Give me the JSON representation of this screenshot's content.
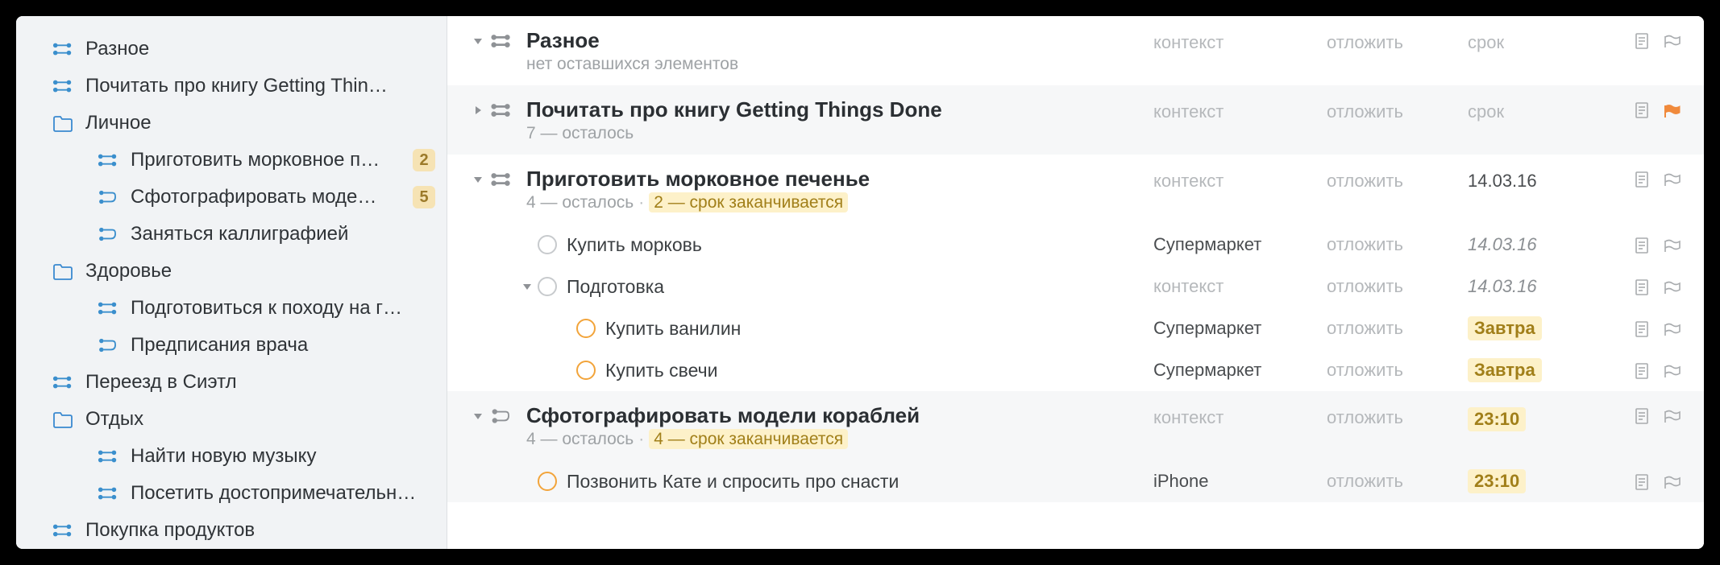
{
  "placeholders": {
    "context": "контекст",
    "defer": "отложить",
    "due": "срок"
  },
  "sidebar": [
    {
      "depth": 0,
      "icon": "parallel",
      "label": "Разное"
    },
    {
      "depth": 0,
      "icon": "parallel",
      "label": "Почитать про книгу Getting Thin…"
    },
    {
      "depth": 0,
      "icon": "folder",
      "label": "Личное"
    },
    {
      "depth": 1,
      "icon": "parallel",
      "label": "Приготовить морковное п…",
      "badge": "2"
    },
    {
      "depth": 1,
      "icon": "sequential",
      "label": "Сфотографировать моде…",
      "badge": "5"
    },
    {
      "depth": 1,
      "icon": "sequential",
      "label": "Заняться каллиграфией"
    },
    {
      "depth": 0,
      "icon": "folder",
      "label": "Здоровье"
    },
    {
      "depth": 1,
      "icon": "parallel",
      "label": "Подготовиться к походу на г…"
    },
    {
      "depth": 1,
      "icon": "sequential",
      "label": "Предписания врача"
    },
    {
      "depth": 0,
      "icon": "parallel",
      "label": "Переезд в Сиэтл"
    },
    {
      "depth": 0,
      "icon": "folder",
      "label": "Отдых"
    },
    {
      "depth": 1,
      "icon": "parallel",
      "label": "Найти новую музыку"
    },
    {
      "depth": 1,
      "icon": "parallel",
      "label": "Посетить достопримечательн…"
    },
    {
      "depth": 0,
      "icon": "parallel",
      "label": "Покупка продуктов"
    }
  ],
  "projects": [
    {
      "alt": false,
      "disclosure": "down",
      "icon": "parallel",
      "title": "Разное",
      "sub_plain": "нет оставшихся элементов",
      "context": "",
      "defer": "",
      "due": "",
      "flag": "empty",
      "tasks": []
    },
    {
      "alt": true,
      "disclosure": "right",
      "icon": "parallel",
      "title": "Почитать про книгу Getting Things Done",
      "sub_remain": "7 — осталось",
      "context": "",
      "defer": "",
      "due": "",
      "flag": "full",
      "tasks": []
    },
    {
      "alt": false,
      "disclosure": "down",
      "icon": "parallel",
      "title": "Приготовить морковное печенье",
      "sub_remain": "4 — осталось",
      "sub_hl": "2 — срок заканчивается",
      "context": "",
      "defer": "",
      "due_val": "14.03.16",
      "flag": "empty",
      "tasks": [
        {
          "indent": 0,
          "warn": false,
          "title": "Купить морковь",
          "context_val": "Супермаркет",
          "defer": "",
          "due_val_italic": "14.03.16"
        },
        {
          "indent": 0,
          "warn": false,
          "disclosure": "down",
          "title": "Подготовка",
          "context": "",
          "defer": "",
          "due_val_italic": "14.03.16"
        },
        {
          "indent": 1,
          "warn": true,
          "title": "Купить ванилин",
          "context_val": "Супермаркет",
          "defer": "",
          "due_hl": "Завтра"
        },
        {
          "indent": 1,
          "warn": true,
          "title": "Купить свечи",
          "context_val": "Супермаркет",
          "defer": "",
          "due_hl": "Завтра"
        }
      ]
    },
    {
      "alt": true,
      "disclosure": "down",
      "icon": "sequential",
      "title": "Сфотографировать модели кораблей",
      "sub_remain": "4 — осталось",
      "sub_hl": "4 — срок заканчивается",
      "context": "",
      "defer": "",
      "due_hl": "23:10",
      "flag": "empty",
      "tasks": [
        {
          "indent": 0,
          "warn": true,
          "title": "Позвонить Кате и спросить про снасти",
          "context_val": "iPhone",
          "defer": "",
          "due_hl": "23:10"
        }
      ]
    }
  ]
}
